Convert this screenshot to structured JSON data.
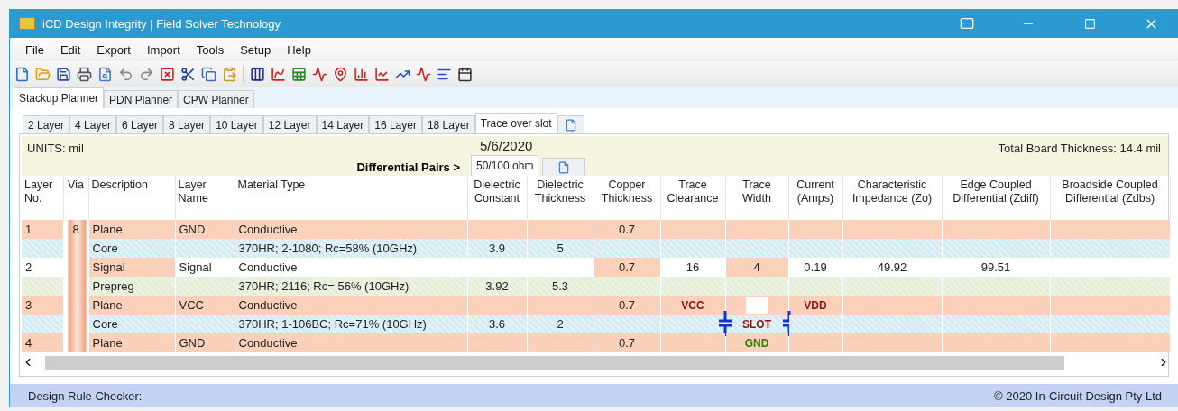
{
  "window": {
    "title": "iCD Design Integrity | Field Solver Technology"
  },
  "menu": [
    "File",
    "Edit",
    "Export",
    "Import",
    "Tools",
    "Setup",
    "Help"
  ],
  "main_tabs": [
    {
      "label": "Stackup Planner",
      "selected": true
    },
    {
      "label": "PDN Planner",
      "selected": false
    },
    {
      "label": "CPW Planner",
      "selected": false
    }
  ],
  "layer_tabs": [
    {
      "label": "2 Layer",
      "selected": false
    },
    {
      "label": "4 Layer",
      "selected": false
    },
    {
      "label": "6 Layer",
      "selected": false
    },
    {
      "label": "8 Layer",
      "selected": false
    },
    {
      "label": "10 Layer",
      "selected": false
    },
    {
      "label": "12 Layer",
      "selected": false
    },
    {
      "label": "14 Layer",
      "selected": false
    },
    {
      "label": "16 Layer",
      "selected": false
    },
    {
      "label": "18 Layer",
      "selected": false
    },
    {
      "label": "Trace over slot",
      "selected": true
    }
  ],
  "header": {
    "units": "UNITS: mil",
    "date": "5/6/2020",
    "total_thickness": "Total Board Thickness: 14.4 mil",
    "diff_pairs_label": "Differential Pairs >",
    "diff_pair_tabs": [
      {
        "label": "50/100 ohm",
        "selected": true
      }
    ]
  },
  "table": {
    "columns": [
      "Layer No.",
      "Via",
      "Description",
      "Layer Name",
      "Material Type",
      "Dielectric Constant",
      "Dielectric Thickness",
      "Copper Thickness",
      "Trace Clearance",
      "Trace Width",
      "Current (Amps)",
      "Characteristic Impedance (Zo)",
      "Edge Coupled Differential (Zdiff)",
      "Broadside Coupled Differential (Zdbs)"
    ],
    "rows": [
      {
        "kind": "plane",
        "cells": [
          "1",
          "8",
          "Plane",
          "GND",
          "Conductive",
          null,
          null,
          "0.7",
          null,
          null,
          null,
          null,
          null,
          null
        ]
      },
      {
        "kind": "core",
        "cells": [
          null,
          null,
          "Core",
          null,
          "370HR; 2-1080; Rc=58% (10GHz)",
          "3.9",
          "5",
          null,
          null,
          null,
          null,
          null,
          null,
          null
        ]
      },
      {
        "kind": "signal",
        "cells": [
          "2",
          null,
          "Signal",
          "Signal",
          "Conductive",
          null,
          null,
          "0.7",
          "16",
          "4",
          "0.19",
          "49.92",
          "99.51",
          null
        ]
      },
      {
        "kind": "prepreg",
        "cells": [
          null,
          null,
          "Prepreg",
          null,
          "370HR; 2116; Rc= 56% (10GHz)",
          "3.92",
          "5.3",
          null,
          null,
          null,
          null,
          null,
          null,
          null
        ]
      },
      {
        "kind": "plane",
        "cells": [
          "3",
          null,
          "Plane",
          "VCC",
          "Conductive",
          null,
          null,
          "0.7",
          {
            "kind": "net",
            "text": "VCC",
            "color": "#8e1414"
          },
          {
            "kind": "gap"
          },
          {
            "kind": "net",
            "text": "VDD",
            "color": "#8e1414"
          },
          null,
          null,
          null
        ]
      },
      {
        "kind": "core",
        "cells": [
          null,
          null,
          "Core",
          null,
          "370HR; 1-106BC; Rc=71% (10GHz)",
          "3.6",
          "2",
          null,
          null,
          {
            "kind": "slot",
            "text": "SLOT",
            "color": "#8e1414"
          },
          null,
          null,
          null,
          null
        ]
      },
      {
        "kind": "plane",
        "cells": [
          "4",
          null,
          "Plane",
          "GND",
          "Conductive",
          null,
          null,
          "0.7",
          null,
          {
            "kind": "net",
            "text": "GND",
            "color": "#2f7a12"
          },
          null,
          null,
          null,
          null
        ]
      }
    ]
  },
  "status_bar": {
    "left": "Design Rule Checker:",
    "right": "© 2020 In-Circuit Design Pty Ltd"
  }
}
